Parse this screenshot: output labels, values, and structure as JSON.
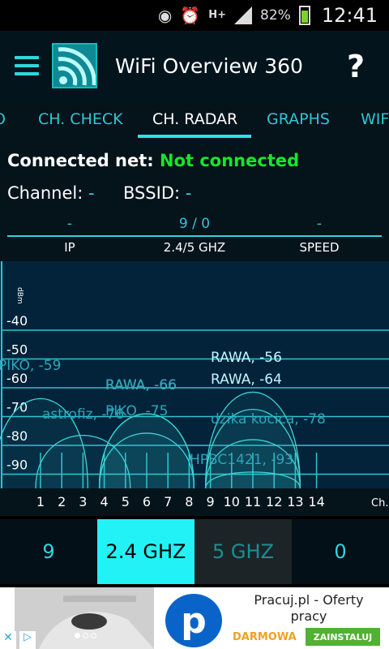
{
  "status_bar": {
    "icons": [
      "eye-icon",
      "alarm-icon",
      "hplus-data-icon",
      "signal-icon"
    ],
    "network_type": "H+",
    "battery_percent": "82%",
    "battery_level": 0.82,
    "time": "12:41"
  },
  "app_bar": {
    "title": "WiFi Overview 360",
    "help": "?"
  },
  "tabs": [
    {
      "label": "O",
      "active": false
    },
    {
      "label": "CH. CHECK",
      "active": false
    },
    {
      "label": "CH. RADAR",
      "active": true
    },
    {
      "label": "GRAPHS",
      "active": false
    },
    {
      "label": "WIF",
      "active": false
    }
  ],
  "connection": {
    "label": "Connected net:",
    "value": "Not connected",
    "channel_label": "Channel:",
    "channel_value": "-",
    "bssid_label": "BSSID:",
    "bssid_value": "-"
  },
  "stats": [
    {
      "value": "-",
      "label": "IP"
    },
    {
      "value": "9 / 0",
      "label": "2.4/5 GHZ"
    },
    {
      "value": "-",
      "label": "SPEED"
    }
  ],
  "chart_data": {
    "type": "area",
    "x_axis_label": "Ch.",
    "x_ticks": [
      1,
      2,
      3,
      4,
      5,
      6,
      7,
      8,
      9,
      10,
      11,
      12,
      13,
      14
    ],
    "y_ticks": [
      -40,
      -50,
      -60,
      -70,
      -80,
      -90
    ],
    "y_label_top": "dBm",
    "networks": [
      {
        "name": "PIKO",
        "signal": -59,
        "channel": 1,
        "label": "PIKO, -59"
      },
      {
        "name": "astrofiz",
        "signal": -76,
        "channel": 3,
        "label": "astrofiz, -76"
      },
      {
        "name": "RAWA",
        "signal": -66,
        "channel": 6,
        "label": "RAWA, -66"
      },
      {
        "name": "RAWA",
        "signal": -66,
        "channel": 6,
        "label": "RAWA, -66"
      },
      {
        "name": "PIKO",
        "signal": -75,
        "channel": 6,
        "label": "PIKO, -75"
      },
      {
        "name": "RAWA",
        "signal": -56,
        "channel": 11,
        "label": "RAWA, -56"
      },
      {
        "name": "RAWA",
        "signal": -64,
        "channel": 11,
        "label": "RAWA, -64"
      },
      {
        "name": "dzika kocica",
        "signal": -78,
        "channel": 11,
        "label": "dzika kocica, -78"
      },
      {
        "name": "HPBC1421",
        "signal": -93,
        "channel": 11,
        "label": "HPBC1421, -93"
      }
    ],
    "colors": {
      "background": "#03233b",
      "grid": "#2fc4d0",
      "curve": "#3ad6d6",
      "label": "#2aa7b8",
      "highlight_label": "#bff7ff"
    }
  },
  "bands": [
    {
      "label": "9",
      "state": "count"
    },
    {
      "label": "2.4 GHZ",
      "state": "selected"
    },
    {
      "label": "5 GHZ",
      "state": "unselected"
    },
    {
      "label": "0",
      "state": "count"
    }
  ],
  "ad": {
    "title": "Pracuj.pl - Oferty pracy",
    "free_label": "DARMOWA",
    "install_label": "ZAINSTALUJ",
    "logo_letter": "p",
    "close": "✕",
    "info": "▷"
  }
}
